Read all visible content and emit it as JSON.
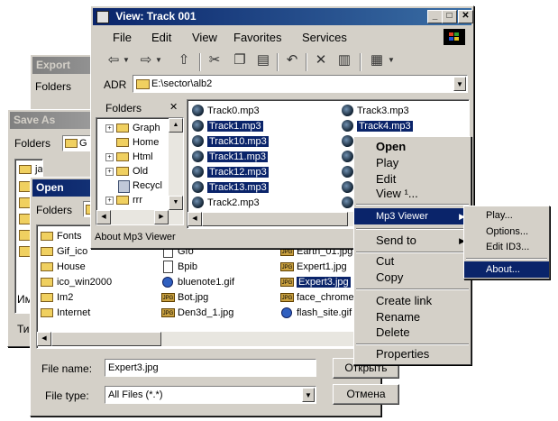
{
  "export_window": {
    "title": "Export",
    "folders_label": "Folders"
  },
  "saveas_window": {
    "title": "Save As",
    "folders_label": "Folders",
    "folder_value": "G",
    "file_items": [
      "jai"
    ],
    "side_labels": [
      "Им",
      "Ти"
    ]
  },
  "open_window": {
    "title": "Open",
    "folders_label": "Folders",
    "col1": [
      "Fonts",
      "Gif_ico",
      "House",
      "ico_win2000",
      "Im2",
      "Internet"
    ],
    "col2": [
      "Gfo",
      "Bpib",
      "bluenote1.gif",
      "Bot.jpg",
      "Den3d_1.jpg"
    ],
    "col3": [
      "Earth_01.jpg",
      "Expert1.jpg",
      "Expert3.jpg",
      "face_chrome.",
      "flash_site.gif"
    ],
    "filename_label": "File name:",
    "filename_value": "Expert3.jpg",
    "filetype_label": "File type:",
    "filetype_value": "All Files (*.*)",
    "open_button": "Открыть",
    "cancel_button": "Отмена"
  },
  "view_window": {
    "title": "View: Track 001",
    "menu": [
      "File",
      "Edit",
      "View",
      "Favorites",
      "Services"
    ],
    "address_label": "ADR",
    "address_value": "E:\\sector\\alb2",
    "folders_title": "Folders",
    "tree": [
      "Graph",
      "Home",
      "Html",
      "Old",
      "Recycl",
      "rrr"
    ],
    "tracks_col1": [
      "Track0.mp3",
      "Track1.mp3",
      "Track10.mp3",
      "Track11.mp3",
      "Track12.mp3",
      "Track13.mp3",
      "Track2.mp3"
    ],
    "tracks_col2": [
      "Track3.mp3",
      "Track4.mp3"
    ],
    "status": "About Mp3 Viewer"
  },
  "context_menu": {
    "items": [
      "Open",
      "Play",
      "Edit",
      "View ¹...",
      "Mp3 Viewer",
      "Send to",
      "Cut",
      "Copy",
      "Create link",
      "Rename",
      "Delete",
      "Properties"
    ]
  },
  "submenu": {
    "items": [
      "Play...",
      "Options...",
      "Edit ID3...",
      "About..."
    ]
  }
}
